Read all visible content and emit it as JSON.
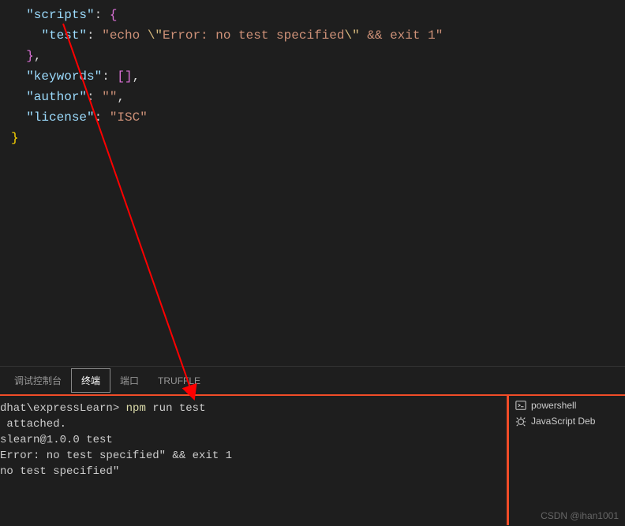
{
  "editor": {
    "lines": [
      {
        "indent": "  ",
        "parts": [
          "\"scripts\"",
          ": ",
          "{"
        ],
        "types": [
          "key",
          "punct",
          "brace-p"
        ]
      },
      {
        "indent": "    ",
        "parts": [
          "\"test\"",
          ": ",
          "\"echo ",
          "\\\"",
          "Error: no test specified",
          "\\\"",
          " && exit 1\""
        ],
        "types": [
          "key",
          "punct",
          "val",
          "esc",
          "val",
          "esc",
          "val"
        ]
      },
      {
        "indent": "  ",
        "parts": [
          "}",
          ","
        ],
        "types": [
          "brace-p",
          "punct"
        ]
      },
      {
        "indent": "  ",
        "parts": [
          "\"keywords\"",
          ": ",
          "[",
          "]",
          ","
        ],
        "types": [
          "key",
          "punct",
          "brace-p",
          "brace-p",
          "punct"
        ]
      },
      {
        "indent": "  ",
        "parts": [
          "\"author\"",
          ": ",
          "\"\"",
          ","
        ],
        "types": [
          "key",
          "punct",
          "val",
          "punct"
        ]
      },
      {
        "indent": "  ",
        "parts": [
          "\"license\"",
          ": ",
          "\"ISC\""
        ],
        "types": [
          "key",
          "punct",
          "val"
        ]
      },
      {
        "indent": "",
        "parts": [
          "}"
        ],
        "types": [
          "brace-y"
        ]
      }
    ]
  },
  "tabs": {
    "items": [
      "调试控制台",
      "终端",
      "端口",
      "TRUFFLE"
    ],
    "activeIndex": 1
  },
  "terminal": {
    "lines": [
      {
        "segments": [
          {
            "t": "dhat\\expressLearn> ",
            "cls": ""
          },
          {
            "t": "npm",
            "cls": "yellow"
          },
          {
            "t": " run test",
            "cls": ""
          }
        ]
      },
      {
        "segments": [
          {
            "t": " attached.",
            "cls": ""
          }
        ]
      },
      {
        "segments": [
          {
            "t": "",
            "cls": ""
          }
        ]
      },
      {
        "segments": [
          {
            "t": "slearn@1.0.0 test",
            "cls": ""
          }
        ]
      },
      {
        "segments": [
          {
            "t": "Error: no test specified\" && exit 1",
            "cls": ""
          }
        ]
      },
      {
        "segments": [
          {
            "t": "",
            "cls": ""
          }
        ]
      },
      {
        "segments": [
          {
            "t": "no test specified\"",
            "cls": ""
          }
        ]
      }
    ],
    "sidebar": [
      {
        "icon": "powershell-icon",
        "label": "powershell"
      },
      {
        "icon": "bug-icon",
        "label": "JavaScript Deb"
      }
    ]
  },
  "watermark": "CSDN @ihan1001"
}
